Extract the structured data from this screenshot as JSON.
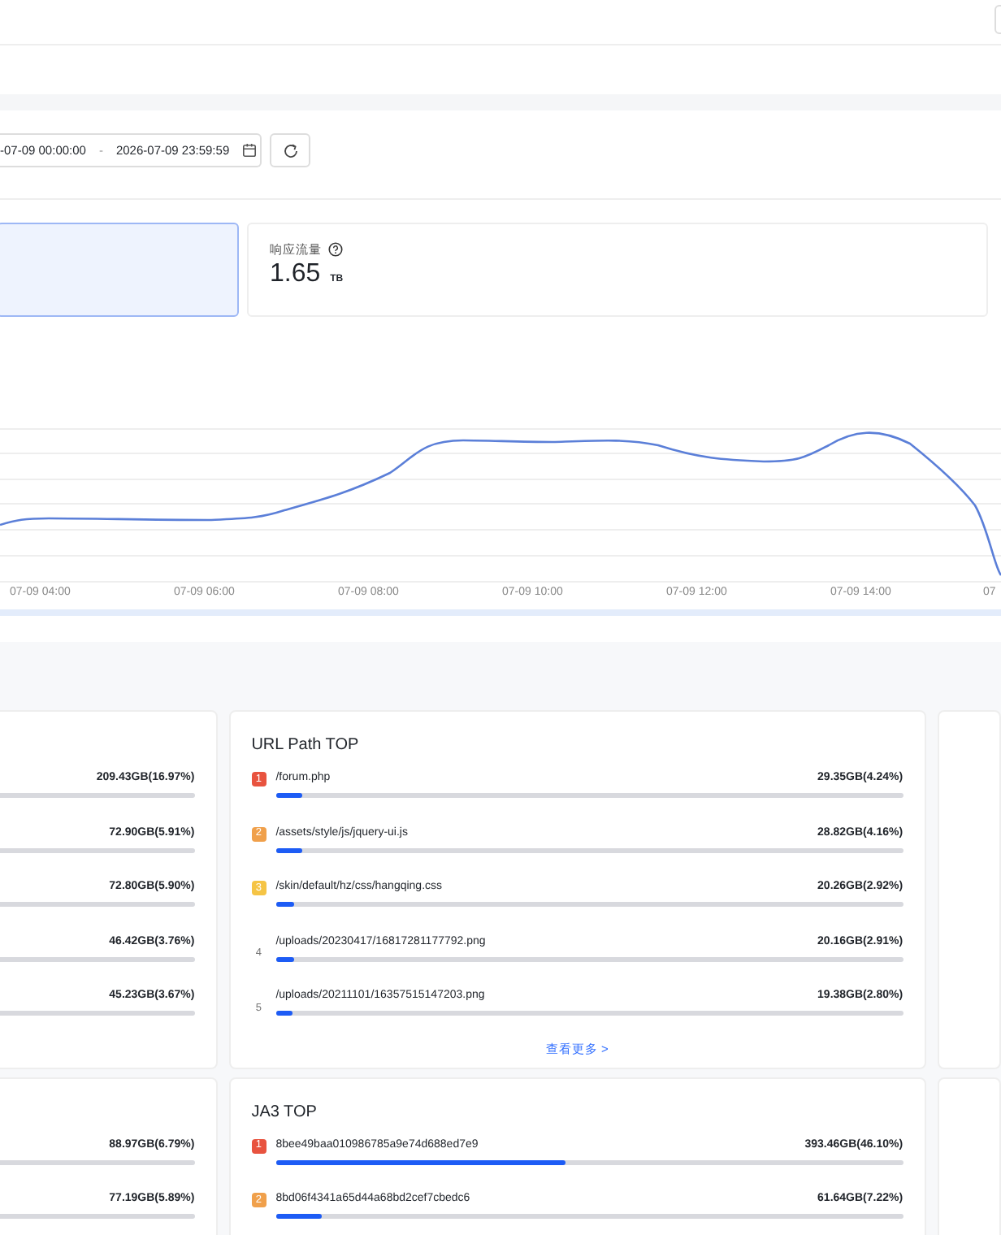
{
  "date_range": {
    "start": "-07-09 00:00:00",
    "separator": "-",
    "end": "2026-07-09 23:59:59"
  },
  "stat_cards": [
    {
      "selected": true
    },
    {
      "label": "响应流量",
      "value": "1.65",
      "unit": "TB",
      "selected": false
    }
  ],
  "chart": {
    "x_labels": [
      "07-09 04:00",
      "07-09 06:00",
      "07-09 08:00",
      "07-09 10:00",
      "07-09 12:00",
      "07-09 14:00",
      "07"
    ],
    "zoom": {
      "level": 1
    }
  },
  "top_panels": [
    {
      "rows": [
        {
          "value": "209.43GB(16.97%)"
        },
        {
          "value": "72.90GB(5.91%)"
        },
        {
          "value": "72.80GB(5.90%)"
        },
        {
          "value": "46.42GB(3.76%)"
        },
        {
          "value": "45.23GB(3.67%)"
        }
      ]
    },
    {
      "title": "URL Path TOP",
      "more": "查看更多 >",
      "rows": [
        {
          "rank": "1",
          "kind": "badge",
          "color": "#e8533f",
          "label": "/forum.php",
          "value": "29.35GB(4.24%)",
          "level": 0.0424
        },
        {
          "rank": "2",
          "kind": "badge",
          "color": "#f0a04b",
          "label": "/assets/style/js/jquery-ui.js",
          "value": "28.82GB(4.16%)",
          "level": 0.0416
        },
        {
          "rank": "3",
          "kind": "badge",
          "color": "#f5c445",
          "label": "/skin/default/hz/css/hangqing.css",
          "value": "20.26GB(2.92%)",
          "level": 0.0292
        },
        {
          "rank": "4",
          "kind": "plain",
          "label": "/uploads/20230417/16817281177792.png",
          "value": "20.16GB(2.91%)",
          "level": 0.0291
        },
        {
          "rank": "5",
          "kind": "plain",
          "label": "/uploads/20211101/16357515147203.png",
          "value": "19.38GB(2.80%)",
          "level": 0.028
        }
      ]
    },
    {
      "rows": [
        {
          "value": "88.97GB(6.79%)"
        },
        {
          "value": "77.19GB(5.89%)"
        }
      ]
    },
    {
      "title": "JA3 TOP",
      "rows": [
        {
          "rank": "1",
          "kind": "badge",
          "color": "#e8533f",
          "label": "8bee49baa010986785a9e74d688ed7e9",
          "value": "393.46GB(46.10%)",
          "level": 0.461
        },
        {
          "rank": "2",
          "kind": "badge",
          "color": "#f0a04b",
          "label": "8bd06f4341a65d44a68bd2cef7cbedc6",
          "value": "61.64GB(7.22%)",
          "level": 0.0722
        }
      ]
    }
  ]
}
